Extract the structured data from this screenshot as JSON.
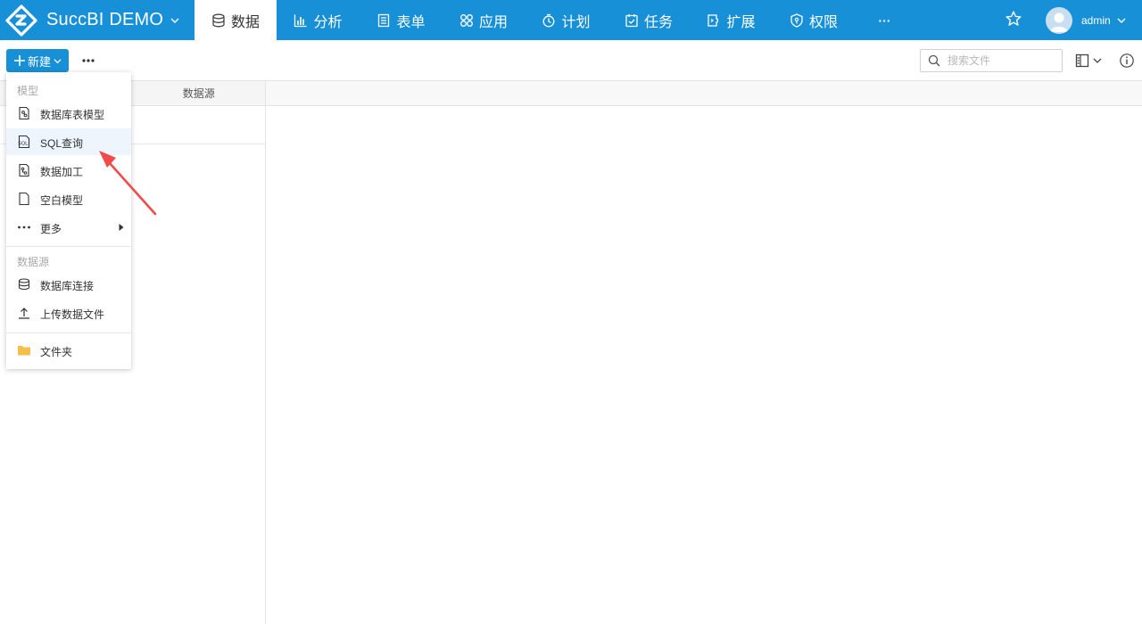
{
  "app": {
    "brand": "SuccBI DEMO"
  },
  "nav": {
    "data": "数据",
    "analysis": "分析",
    "form": "表单",
    "app": "应用",
    "plan": "计划",
    "task": "任务",
    "extend": "扩展",
    "permission": "权限",
    "more": "···"
  },
  "user": {
    "name": "admin"
  },
  "toolbar": {
    "new_label": "新建",
    "search_placeholder": "搜索文件"
  },
  "left_panel": {
    "tabs": [
      "",
      "数据源"
    ]
  },
  "new_menu": {
    "model_header": "模型",
    "model_items": [
      "数据库表模型",
      "SQL查询",
      "数据加工",
      "空白模型",
      "更多"
    ],
    "source_header": "数据源",
    "source_items": [
      "数据库连接",
      "上传数据文件"
    ],
    "folder_item": "文件夹"
  },
  "colors": {
    "topbar": "#1890d7",
    "folder": "#f5c04a",
    "annotation_arrow": "#f04a4a"
  },
  "icons": [
    "logo-icon",
    "database-icon",
    "bar-chart-icon",
    "form-icon",
    "apps-icon",
    "timer-icon",
    "task-icon",
    "extension-icon",
    "shield-icon",
    "star-icon",
    "avatar-icon",
    "plus-icon",
    "more-icon",
    "search-icon",
    "layout-icon",
    "info-icon",
    "table-model-icon",
    "sql-icon",
    "data-process-icon",
    "blank-file-icon",
    "database-connection-icon",
    "upload-icon",
    "folder-icon"
  ]
}
